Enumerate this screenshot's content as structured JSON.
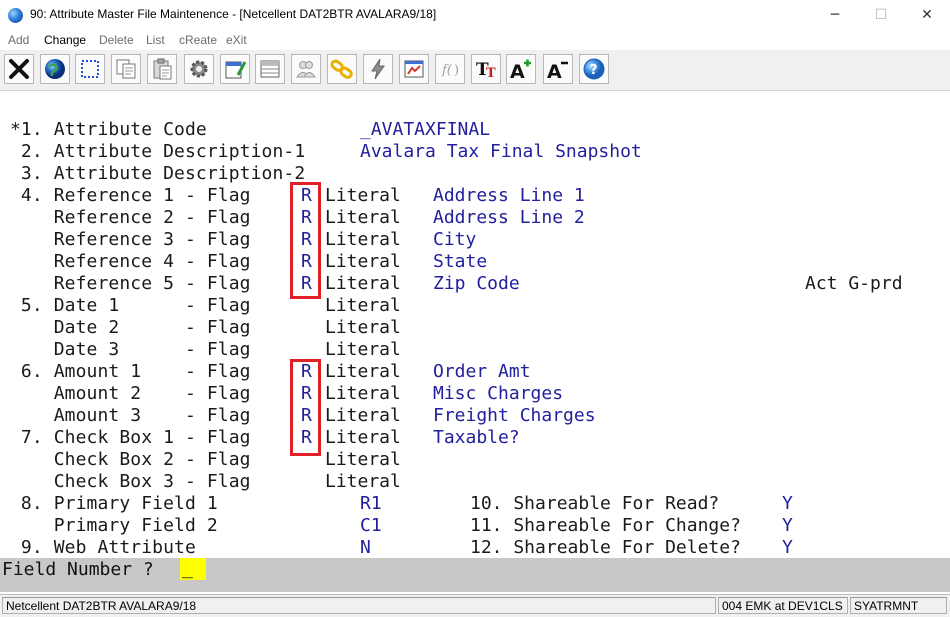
{
  "window": {
    "title": "90: Attribute Master File Maintenence - [Netcellent DAT2BTR AVALARA9/18]",
    "minimize": "─",
    "maximize": "☐",
    "close": "✕"
  },
  "menu": [
    "Add",
    "Change",
    "Delete",
    "List",
    "cReate",
    "eXit"
  ],
  "toolbar": [
    "close-x-icon",
    "globe-icon",
    "select-rect-icon",
    "copy-icon",
    "paste-icon",
    "gear-icon",
    "edit-form-icon",
    "table-icon",
    "users-icon",
    "chain-link-icon",
    "lightning-icon",
    "chart-window-icon",
    "script-fx-icon",
    "text-format-icon",
    "font-grow-icon",
    "font-shrink-icon",
    "help-icon"
  ],
  "lines": [
    "*1. Attribute Code",
    " 2. Attribute Description-1",
    " 3. Attribute Description-2",
    " 4. Reference 1 - Flag",
    "    Reference 2 - Flag",
    "    Reference 3 - Flag",
    "    Reference 4 - Flag",
    "    Reference 5 - Flag",
    " 5. Date 1      - Flag",
    "    Date 2      - Flag",
    "    Date 3      - Flag",
    " 6. Amount 1    - Flag",
    "    Amount 2    - Flag",
    "    Amount 3    - Flag",
    " 7. Check Box 1 - Flag",
    "    Check Box 2 - Flag",
    "    Check Box 3 - Flag",
    " 8. Primary Field 1",
    "    Primary Field 2",
    " 9. Web Attribute"
  ],
  "attribute_code": "_AVATAXFINAL",
  "description_1": "Avalara Tax Final Snapshot",
  "literal_word": "Literal",
  "flags": [
    "R",
    "R",
    "R",
    "R",
    "R",
    "",
    "",
    "",
    "R",
    "R",
    "R",
    "R",
    "",
    ""
  ],
  "literals": [
    "Address Line 1",
    "Address Line 2",
    "City",
    "State",
    "Zip Code",
    "",
    "",
    "",
    "Order Amt",
    "Misc Charges",
    "Freight Charges",
    "Taxable?",
    "",
    ""
  ],
  "side_note": "Act G-prd",
  "primary_field_1": "R1",
  "primary_field_2": "C1",
  "web_attribute": "N",
  "shareable": [
    {
      "label": "10. Shareable For Read?",
      "value": "Y"
    },
    {
      "label": "11. Shareable For Change?",
      "value": "Y"
    },
    {
      "label": "12. Shareable For Delete?",
      "value": "Y"
    }
  ],
  "prompt": {
    "label": "Field Number ?",
    "value": "_"
  },
  "status": {
    "company": "Netcellent DAT2BTR AVALARA9/18",
    "user": "004 EMK at DEV1CLS",
    "program": "SYATRMNT"
  },
  "colors": {
    "value_text": "#22209c",
    "highlight_box": "#e01f26",
    "prompt_input": "#ffff00"
  }
}
